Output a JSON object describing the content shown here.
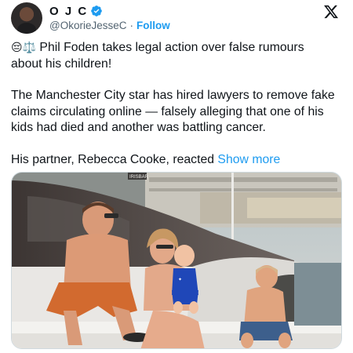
{
  "author": {
    "display_name": "O J C",
    "handle": "@OkorieJesseC",
    "follow_label": "Follow",
    "verified": true,
    "separator": "·"
  },
  "tweet": {
    "headline_emojis": "😔⚖️",
    "headline": "Phil Foden takes legal action over false rumours about his children!",
    "paragraph": "The Manchester City star has hired lawyers to remove fake claims circulating online — falsely alleging that one of his kids had died and another was battling cancer.",
    "tail": "His partner, Rebecca Cooke, reacted",
    "show_more_label": "Show more"
  },
  "media": {
    "sign_text": "IRISBAR"
  },
  "colors": {
    "accent": "#1d9bf0",
    "text": "#0f1419",
    "secondary": "#536471"
  }
}
